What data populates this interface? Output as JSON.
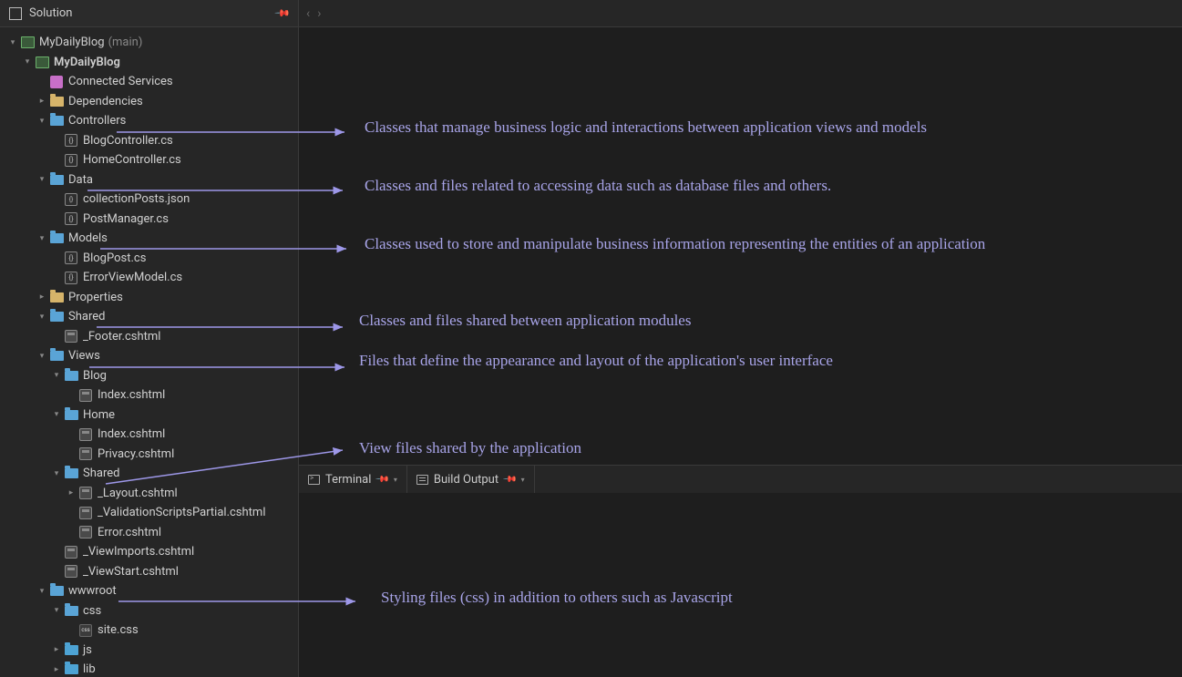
{
  "panel": {
    "title": "Solution"
  },
  "solution": {
    "name": "MyDailyBlog",
    "branch": "(main)"
  },
  "project": {
    "name": "MyDailyBlog"
  },
  "nodes": {
    "connected": "Connected Services",
    "deps": "Dependencies",
    "controllers": "Controllers",
    "blogctrl": "BlogController.cs",
    "homectrl": "HomeController.cs",
    "data": "Data",
    "collposts": "collectionPosts.json",
    "postmgr": "PostManager.cs",
    "models": "Models",
    "blogpost": "BlogPost.cs",
    "errvm": "ErrorViewModel.cs",
    "props": "Properties",
    "shared": "Shared",
    "footer": "_Footer.cshtml",
    "views": "Views",
    "blog": "Blog",
    "blogindex": "Index.cshtml",
    "home": "Home",
    "homeindex": "Index.cshtml",
    "privacy": "Privacy.cshtml",
    "vshared": "Shared",
    "layout": "_Layout.cshtml",
    "valscripts": "_ValidationScriptsPartial.cshtml",
    "errorv": "Error.cshtml",
    "vimports": "_ViewImports.cshtml",
    "vstart": "_ViewStart.cshtml",
    "wwwroot": "wwwroot",
    "css": "css",
    "sitecss": "site.css",
    "js": "js",
    "lib": "lib"
  },
  "tabs": {
    "terminal": "Terminal",
    "build": "Build Output"
  },
  "annots": {
    "controllers": "Classes that manage business logic and interactions between application views and models",
    "data": "Classes and files related to accessing data such as database files and others.",
    "models": "Classes used to store and manipulate business information representing the entities of an application",
    "shared": "Classes and files shared between application modules",
    "views": "Files that define the appearance and layout of the application's user interface",
    "vshared": "View files shared by the application",
    "wwwroot": "Styling files (css) in addition to others such as Javascript"
  }
}
